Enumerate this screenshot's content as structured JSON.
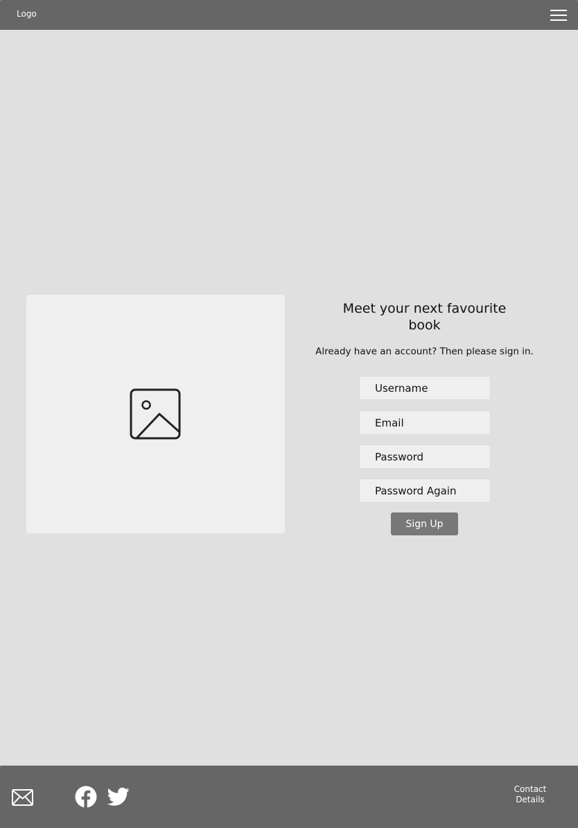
{
  "header": {
    "logo": "Logo",
    "menu_icon": "hamburger-menu-icon"
  },
  "hero_image": {
    "icon": "image-placeholder-icon"
  },
  "signup": {
    "title": "Meet your next favourite book",
    "subtitle": "Already have an account? Then please sign in.",
    "fields": {
      "username_placeholder": "Username",
      "email_placeholder": "Email",
      "password_placeholder": "Password",
      "password_again_placeholder": "Password Again"
    },
    "submit_label": "Sign Up"
  },
  "footer": {
    "icons": [
      "mail-icon",
      "facebook-icon",
      "twitter-icon"
    ],
    "contact_label_line1": "Contact",
    "contact_label_line2": "Details"
  },
  "colors": {
    "background": "#e0e0e0",
    "bar": "#666666",
    "panel": "#efefef",
    "button": "#787878",
    "text_light": "#ffffff",
    "text_dark": "#111111"
  }
}
